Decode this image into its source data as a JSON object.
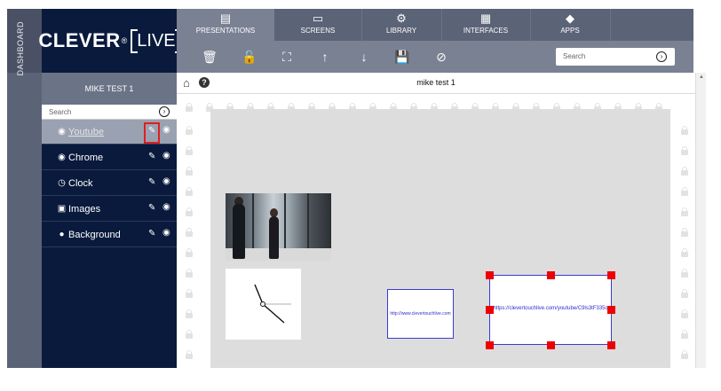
{
  "dashboard": {
    "label": "DASHBOARD"
  },
  "logo": {
    "brand": "CLEVER",
    "reg": "®",
    "live": "LIVE"
  },
  "presentation": {
    "name": "MIKE TEST 1",
    "title": "mike test 1"
  },
  "sidebar_search": {
    "placeholder": "Search"
  },
  "sidebar_items": [
    {
      "label": "Youtube",
      "icon": "youtube-icon"
    },
    {
      "label": "Chrome",
      "icon": "chrome-icon"
    },
    {
      "label": "Clock",
      "icon": "clock-icon"
    },
    {
      "label": "Images",
      "icon": "images-icon"
    },
    {
      "label": "Background",
      "icon": "background-icon"
    }
  ],
  "tabs": [
    {
      "label": "PRESENTATIONS",
      "icon": "presentations-icon"
    },
    {
      "label": "SCREENS",
      "icon": "screens-icon"
    },
    {
      "label": "LIBRARY",
      "icon": "library-icon"
    },
    {
      "label": "INTERFACES",
      "icon": "interfaces-icon"
    },
    {
      "label": "APPS",
      "icon": "apps-icon"
    }
  ],
  "toolbar": {
    "tools": [
      "delete-icon",
      "unlock-icon",
      "fullscreen-icon",
      "move-up-icon",
      "move-down-icon",
      "save-icon",
      "disable-icon"
    ],
    "search_placeholder": "Search"
  },
  "widgets": {
    "url_small": "http://www.clevertouchlive.com",
    "url_large": "https://clevertouchlive.com/youtube/C9ls3tF335c"
  },
  "colors": {
    "sidebar": "#0a1a3d",
    "nav": "#5b6377",
    "toolbar": "#7a8193",
    "stage": "#dddddd",
    "selection_handles": "#ee0000",
    "highlight_box": "#e01f1f"
  }
}
